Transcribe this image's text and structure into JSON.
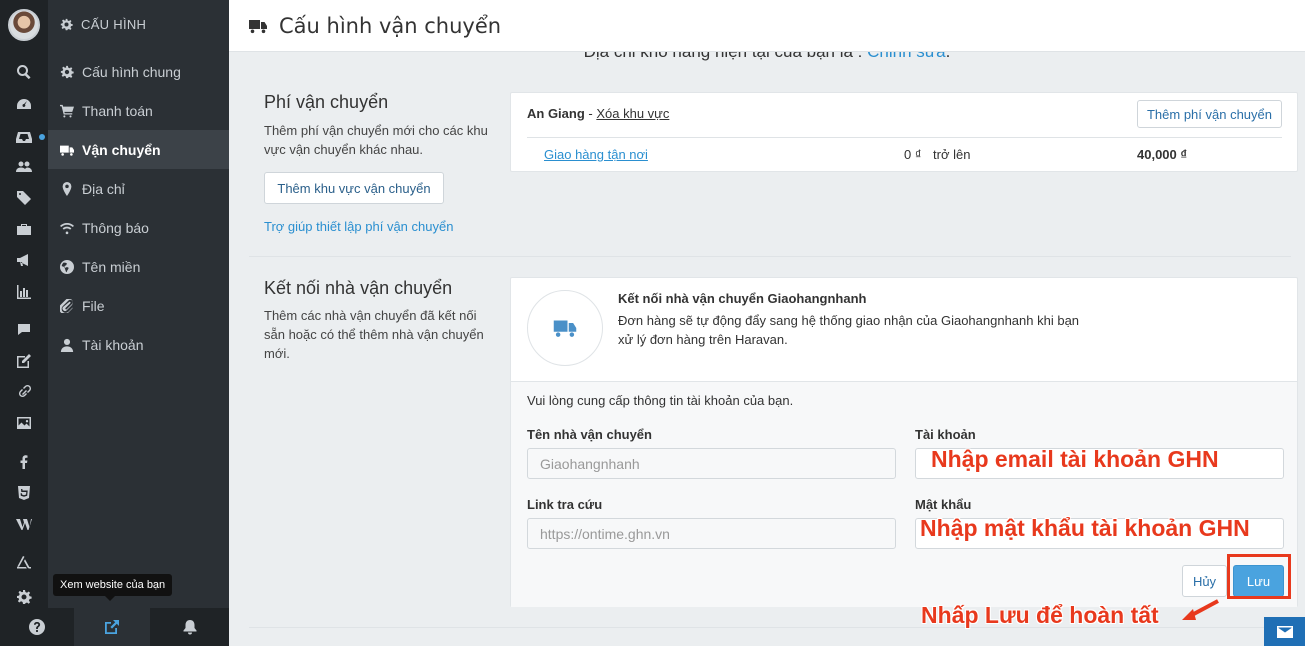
{
  "sidebar": {
    "header": "CẤU HÌNH",
    "items": [
      {
        "label": "Cấu hình chung"
      },
      {
        "label": "Thanh toán"
      },
      {
        "label": "Vận chuyển"
      },
      {
        "label": "Địa chỉ"
      },
      {
        "label": "Thông báo"
      },
      {
        "label": "Tên miền"
      },
      {
        "label": "File"
      },
      {
        "label": "Tài khoản"
      }
    ],
    "tooltip": "Xem website của bạn"
  },
  "page": {
    "title": "Cấu hình vận chuyển",
    "warehouse_text": "Địa chỉ kho hàng hiện tại của bạn là :",
    "warehouse_link": "Chỉnh sửa",
    "warehouse_suffix": "."
  },
  "shipping_fee": {
    "title": "Phí vận chuyển",
    "desc": "Thêm phí vận chuyển mới cho các khu vực vận chuyển khác nhau.",
    "add_zone_button": "Thêm khu vực vận chuyển",
    "help_link": "Trợ giúp thiết lập phí vận chuyển",
    "zone": {
      "name": "An Giang",
      "separator": " - ",
      "delete_link": "Xóa khu vực",
      "add_fee_button": "Thêm phí vận chuyển",
      "rate": {
        "name": "Giao hàng tận nơi",
        "min": "0 ₫",
        "range": "trở lên",
        "price": "40,000 ₫"
      }
    }
  },
  "carrier": {
    "title": "Kết nối nhà vận chuyển",
    "desc": "Thêm các nhà vận chuyển đã kết nối sẵn hoặc có thể thêm nhà vận chuyển mới.",
    "card_title": "Kết nối nhà vận chuyển Giaohangnhanh",
    "card_desc": "Đơn hàng sẽ tự động đẩy sang hệ thống giao nhận của Giaohangnhanh khi bạn xử lý đơn hàng trên Haravan.",
    "form_intro": "Vui lòng cung cấp thông tin tài khoản của bạn.",
    "carrier_name_label": "Tên nhà vận chuyển",
    "carrier_name_value": "Giaohangnhanh",
    "account_label": "Tài khoản",
    "tracking_label": "Link tra cứu",
    "tracking_value": "https://ontime.ghn.vn",
    "password_label": "Mật khẩu",
    "cancel_button": "Hủy",
    "save_button": "Lưu"
  },
  "annotations": {
    "email_hint": "Nhập email tài khoản GHN",
    "password_hint": "Nhập mật khẩu tài khoản GHN",
    "save_hint": "Nhấp Lưu để hoàn tất",
    "color": "#e8391d"
  }
}
